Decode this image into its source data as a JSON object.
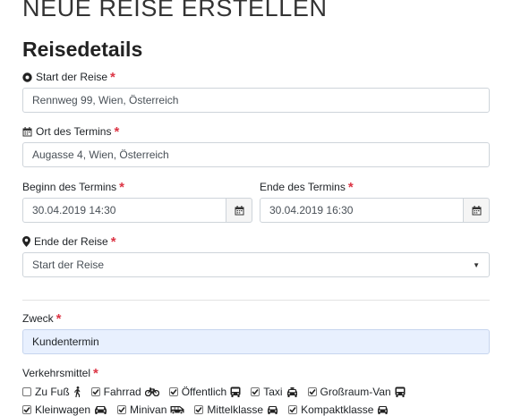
{
  "header": {
    "title": "NEUE REISE ERSTELLEN"
  },
  "section": {
    "title": "Reisedetails"
  },
  "required_mark": "*",
  "fields": {
    "start": {
      "label": "Start der Reise",
      "value": "Rennweg 99, Wien, Österreich",
      "icon": "dot-circle-icon"
    },
    "location": {
      "label": "Ort des Termins",
      "value": "Augasse 4, Wien, Österreich",
      "icon": "calendar-icon"
    },
    "begin": {
      "label": "Beginn des Termins",
      "value": "30.04.2019 14:30"
    },
    "end_time": {
      "label": "Ende des Termins",
      "value": "30.04.2019 16:30"
    },
    "trip_end": {
      "label": "Ende der Reise",
      "selected": "Start der Reise",
      "icon": "map-marker-icon"
    },
    "purpose": {
      "label": "Zweck",
      "value": "Kundentermin"
    }
  },
  "transport": {
    "label": "Verkehrsmittel",
    "row1": [
      {
        "label": "Zu Fuß",
        "checked": false,
        "icon": "walking-icon"
      },
      {
        "label": "Fahrrad",
        "checked": true,
        "icon": "bicycle-icon"
      },
      {
        "label": "Öffentlich",
        "checked": true,
        "icon": "bus-icon"
      },
      {
        "label": "Taxi",
        "checked": true,
        "icon": "taxi-icon"
      },
      {
        "label": "Großraum-Van",
        "checked": true,
        "icon": "bus-icon"
      }
    ],
    "row2": [
      {
        "label": "Kleinwagen",
        "checked": true,
        "icon": "car-icon"
      },
      {
        "label": "Minivan",
        "checked": true,
        "icon": "van-icon"
      },
      {
        "label": "Mittelklasse",
        "checked": true,
        "icon": "car-icon"
      },
      {
        "label": "Kompaktklasse",
        "checked": true,
        "icon": "car-icon"
      }
    ]
  }
}
